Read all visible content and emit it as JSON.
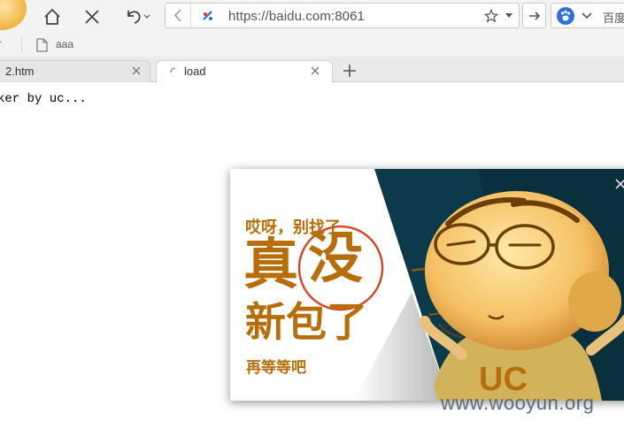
{
  "toolbar": {
    "url": "https://baidu.com:8061",
    "search_engine_label": "百度",
    "icons": [
      "home-icon",
      "stop-icon",
      "undo-icon",
      "back-icon",
      "site-icon",
      "star-icon",
      "dropdown-icon",
      "go-icon",
      "paw-icon"
    ]
  },
  "bookmarks": {
    "item_label": "aaa"
  },
  "tabs": [
    {
      "label": "2.htm",
      "active": false
    },
    {
      "label": "load",
      "active": true
    }
  ],
  "page": {
    "body_text": "ker by uc..."
  },
  "popup": {
    "line1": "哎呀，别找了",
    "big1": "真",
    "big2": "没",
    "big3": "新包了",
    "line4": "再等等吧",
    "mascot_shirt_text": "UC",
    "colors": {
      "accent": "#b86e08",
      "dark_bg": "#0d3a4a",
      "circle": "#d24a2a"
    }
  },
  "watermark": "www.wooyun.org"
}
